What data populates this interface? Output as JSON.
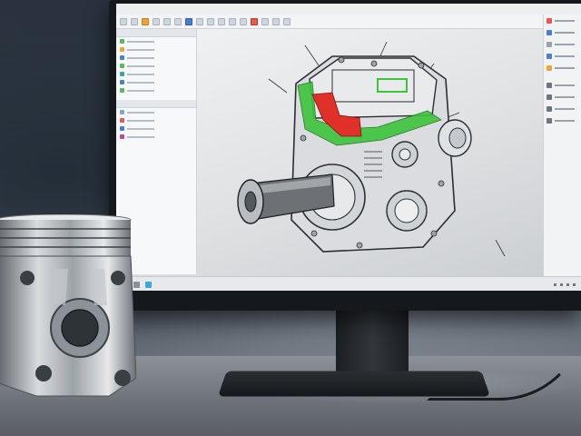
{
  "scene": {
    "description_visible_text": "",
    "colors": {
      "screen_bg": "#e6e8ea",
      "model_gray": "#d9dcdf",
      "model_outline": "#2b2f33",
      "highlight_green": "#3cc43c",
      "highlight_red": "#e0302a",
      "metal": "#b8bcc0"
    }
  },
  "icons": {
    "toolbar": [
      "tool-icon",
      "tool-icon",
      "tool-icon",
      "tool-icon",
      "tool-icon"
    ],
    "taskbar": [
      "start-icon",
      "search-icon",
      "app-icon"
    ]
  }
}
